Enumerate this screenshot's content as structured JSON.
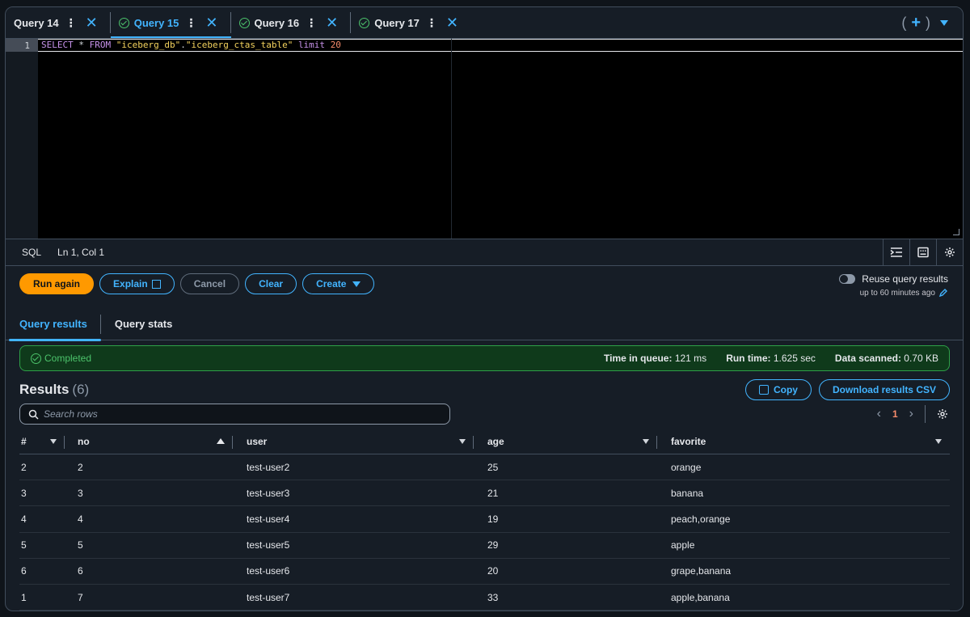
{
  "query_tabs": [
    {
      "label": "Query 14",
      "completed": false,
      "active": false
    },
    {
      "label": "Query 15",
      "completed": true,
      "active": true
    },
    {
      "label": "Query 16",
      "completed": true,
      "active": false
    },
    {
      "label": "Query 17",
      "completed": true,
      "active": false
    }
  ],
  "editor": {
    "line_number": "1",
    "code": {
      "select": "SELECT",
      "star": " * ",
      "from": "FROM",
      "space": " ",
      "db": "\"iceberg_db\"",
      "dot": ".",
      "table": "\"iceberg_ctas_table\"",
      "space2": " ",
      "limit": "limit",
      "space3": " ",
      "limit_value": "20"
    }
  },
  "statusbar": {
    "language": "SQL",
    "position": "Ln 1, Col 1"
  },
  "actions": {
    "run_again": "Run again",
    "explain": "Explain",
    "cancel": "Cancel",
    "clear": "Clear",
    "create": "Create"
  },
  "reuse": {
    "label": "Reuse query results",
    "sub": "up to 60 minutes ago"
  },
  "result_tabs": {
    "results": "Query results",
    "stats": "Query stats"
  },
  "banner": {
    "status": "Completed",
    "queue_label": "Time in queue:",
    "queue_value": "121 ms",
    "run_label": "Run time:",
    "run_value": "1.625 sec",
    "scanned_label": "Data scanned:",
    "scanned_value": "0.70 KB"
  },
  "results": {
    "title": "Results",
    "count": "(6)",
    "copy": "Copy",
    "download": "Download results CSV",
    "search_placeholder": "Search rows",
    "page": "1"
  },
  "table": {
    "columns": [
      "#",
      "no",
      "user",
      "age",
      "favorite"
    ],
    "rows": [
      [
        "2",
        "2",
        "test-user2",
        "25",
        "orange"
      ],
      [
        "3",
        "3",
        "test-user3",
        "21",
        "banana"
      ],
      [
        "4",
        "4",
        "test-user4",
        "19",
        "peach,orange"
      ],
      [
        "5",
        "5",
        "test-user5",
        "29",
        "apple"
      ],
      [
        "6",
        "6",
        "test-user6",
        "20",
        "grape,banana"
      ],
      [
        "1",
        "7",
        "test-user7",
        "33",
        "apple,banana"
      ]
    ]
  },
  "colors": {
    "accent": "#42b4ff",
    "primary": "#ff9900",
    "success": "#4cc36b"
  }
}
